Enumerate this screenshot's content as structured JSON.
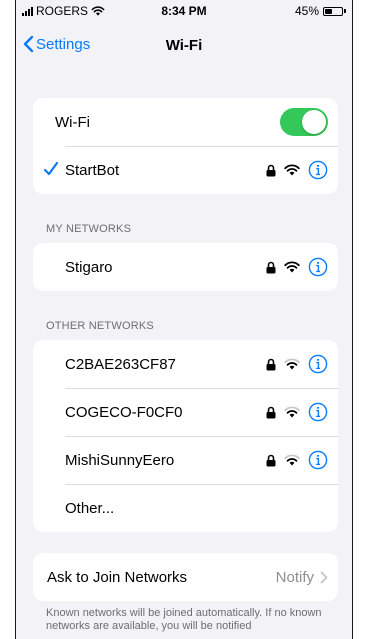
{
  "status_bar": {
    "carrier": "ROGERS",
    "time": "8:34 PM",
    "battery_percent": "45%",
    "battery_level": 0.45
  },
  "nav": {
    "back_label": "Settings",
    "title": "Wi-Fi"
  },
  "wifi_toggle": {
    "label": "Wi-Fi",
    "on": true,
    "on_color": "#34c759"
  },
  "connected": {
    "name": "StartBot"
  },
  "my_networks": {
    "header": "MY NETWORKS",
    "items": [
      {
        "name": "Stigaro"
      }
    ]
  },
  "other_networks": {
    "header": "OTHER NETWORKS",
    "items": [
      {
        "name": "C2BAE263CF87"
      },
      {
        "name": "COGECO-F0CF0"
      },
      {
        "name": "MishiSunnyEero"
      }
    ],
    "other_label": "Other..."
  },
  "ask_to_join": {
    "label": "Ask to Join Networks",
    "value": "Notify"
  },
  "footer": {
    "text": "Known networks will be joined automatically. If no known networks are available, you will be notified"
  },
  "colors": {
    "accent": "#0a7aff",
    "group_bg": "#f2f2f7"
  },
  "icons": [
    "wifi-icon",
    "lock-icon",
    "info-icon",
    "checkmark-icon",
    "chevron-left-icon",
    "chevron-right-icon",
    "battery-icon",
    "signal-icon"
  ]
}
